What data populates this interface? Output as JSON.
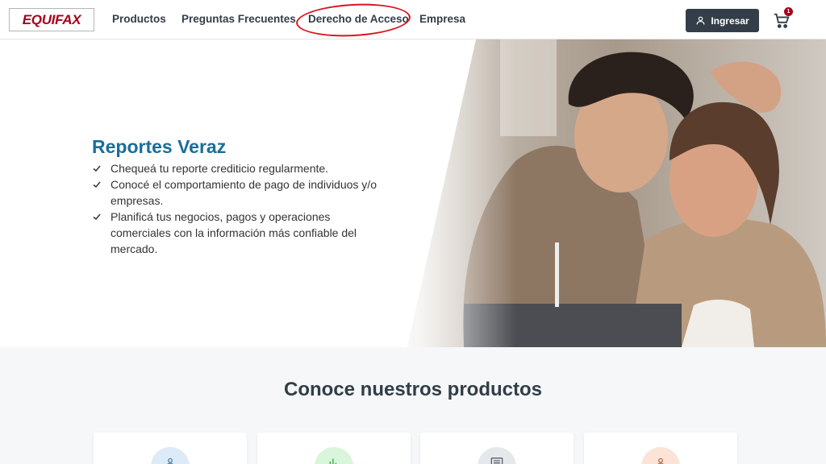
{
  "brand": {
    "logo_text": "EQUIFAX",
    "color": "#a8001a"
  },
  "nav": {
    "items": [
      {
        "label": "Productos"
      },
      {
        "label": "Preguntas Frecuentes"
      },
      {
        "label": "Derecho de Acceso",
        "highlighted": true
      },
      {
        "label": "Empresa"
      }
    ],
    "login_label": "Ingresar",
    "login_icon": "user-icon",
    "cart_icon": "cart-icon",
    "cart_count": "1",
    "highlight_color": "#d8161e"
  },
  "hero": {
    "title": "Reportes Veraz",
    "title_color": "#1b6d98",
    "bullets": [
      "Chequeá tu reporte crediticio regularmente.",
      "Conocé el comportamiento de pago de individuos y/o empresas.",
      "Planificá tus negocios, pagos y operaciones comerciales con la información más confiable del mercado."
    ]
  },
  "products": {
    "title": "Conoce nuestros productos",
    "cards": [
      {
        "icon": "person-icon",
        "icon_bg": "#dcebf7",
        "icon_color": "#4f7fa6"
      },
      {
        "icon": "chart-icon",
        "icon_bg": "#d9f5dc",
        "icon_color": "#3a9b47"
      },
      {
        "icon": "document-icon",
        "icon_bg": "#e6e9ec",
        "icon_color": "#59636d"
      },
      {
        "icon": "person-icon",
        "icon_bg": "#fbe3d8",
        "icon_color": "#b36a4a"
      }
    ]
  }
}
